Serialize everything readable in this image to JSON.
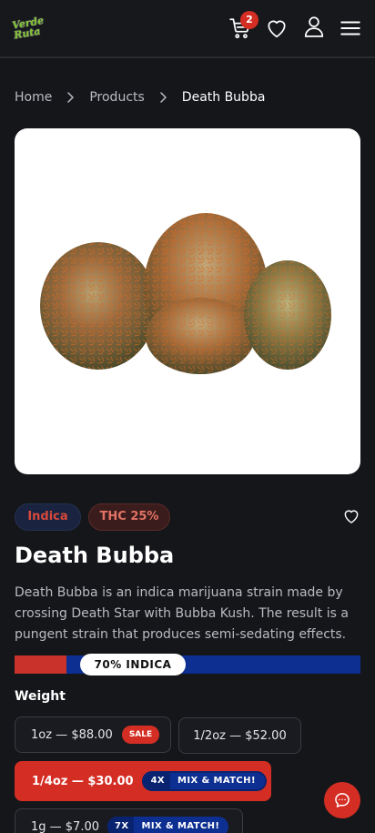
{
  "header": {
    "logo_text": "Verde\nRuta",
    "cart_count": "2",
    "icons": [
      "cart-icon",
      "heart-icon",
      "user-icon",
      "menu-icon"
    ]
  },
  "breadcrumb": {
    "items": [
      "Home",
      "Products"
    ],
    "current": "Death Bubba"
  },
  "product": {
    "type_tag": "Indica",
    "thc_tag": "THC 25%",
    "title": "Death Bubba",
    "description": "Death Bubba is an indica marijuana strain made by crossing Death Star with Bubba Kush. The result is a pungent strain that produces semi-sedating effects.",
    "strain_label": "70% INDICA",
    "indica_fraction": 0.15
  },
  "weight": {
    "label": "Weight",
    "options": [
      {
        "label": "1oz — $88.00",
        "badge": "SALE"
      },
      {
        "label": "1/2oz — $52.00"
      },
      {
        "label": "1/4oz — $30.00",
        "mix_count": "4X",
        "mix_label": "MIX & MATCH!",
        "selected": true
      },
      {
        "label": "1g — $7.00",
        "mix_count": "7X",
        "mix_label": "MIX & MATCH!"
      }
    ]
  },
  "colors": {
    "accent_red": "#d42e24",
    "indica_blue": "#0d2f91",
    "background": "#15161a"
  }
}
